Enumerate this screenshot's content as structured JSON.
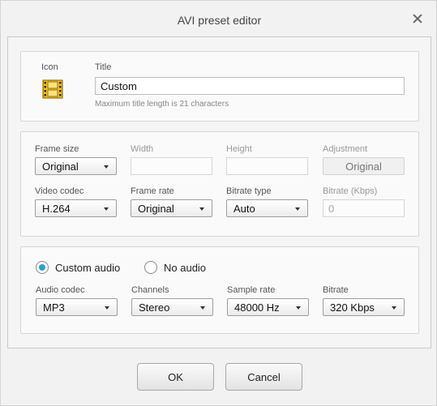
{
  "window": {
    "title": "AVI preset editor"
  },
  "general": {
    "icon_label": "Icon",
    "title_label": "Title",
    "title_value": "Custom",
    "title_hint": "Maximum title length is 21 characters"
  },
  "video": {
    "frame_size_label": "Frame size",
    "frame_size_value": "Original",
    "width_label": "Width",
    "width_value": "",
    "height_label": "Height",
    "height_value": "",
    "adjustment_label": "Adjustment",
    "adjustment_value": "Original",
    "codec_label": "Video codec",
    "codec_value": "H.264",
    "frame_rate_label": "Frame rate",
    "frame_rate_value": "Original",
    "bitrate_type_label": "Bitrate type",
    "bitrate_type_value": "Auto",
    "bitrate_label": "Bitrate (Kbps)",
    "bitrate_value": "0"
  },
  "audio": {
    "custom_audio_label": "Custom audio",
    "no_audio_label": "No audio",
    "codec_label": "Audio codec",
    "codec_value": "MP3",
    "channels_label": "Channels",
    "channels_value": "Stereo",
    "sample_rate_label": "Sample rate",
    "sample_rate_value": "48000 Hz",
    "bitrate_label": "Bitrate",
    "bitrate_value": "320 Kbps"
  },
  "buttons": {
    "ok": "OK",
    "cancel": "Cancel"
  },
  "colors": {
    "accent": "#2a9fd6",
    "film_icon": "#f2c21b"
  }
}
